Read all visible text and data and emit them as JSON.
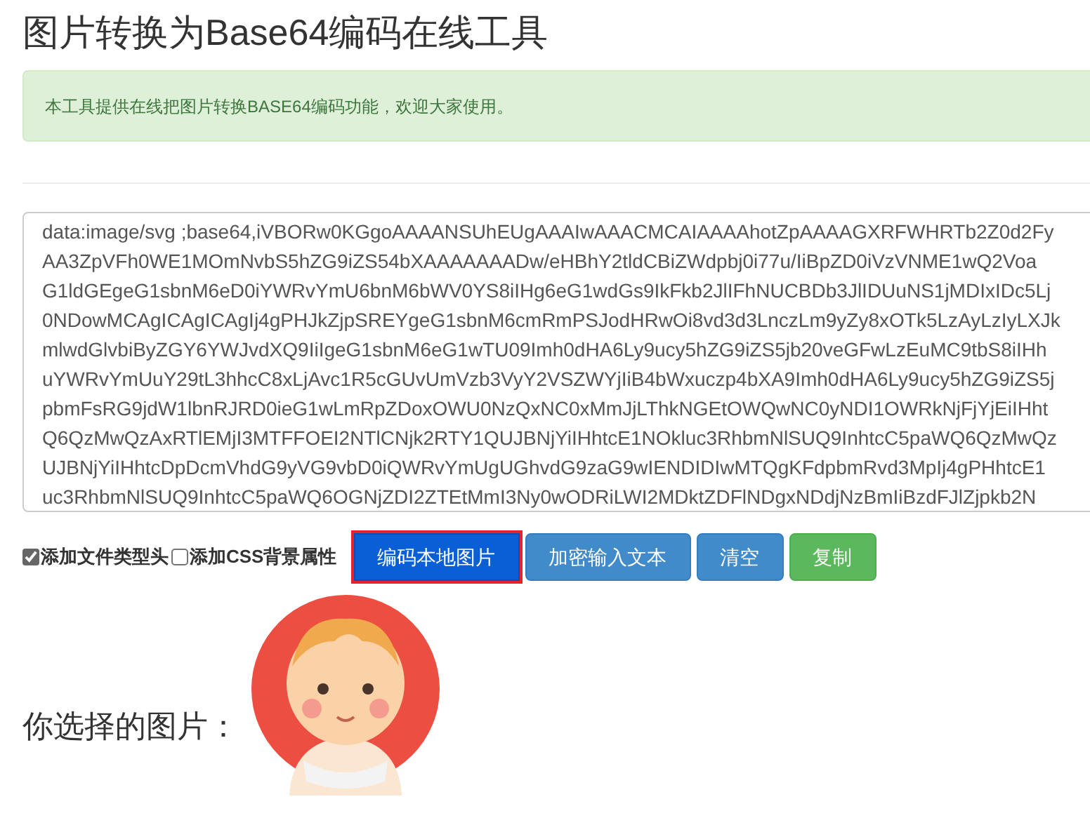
{
  "title": "图片转换为Base64编码在线工具",
  "notice": "本工具提供在线把图片转换BASE64编码功能，欢迎大家使用。",
  "base64_lines": [
    "data:image/svg ;base64,iVBORw0KGgoAAAANSUhEUgAAAIwAAACMCAIAAAAhotZpAAAAGXRFWHRTb2Z0d2Fy",
    "AA3ZpVFh0WE1MOmNvbS5hZG9iZS54bXAAAAAAADw/eHBhY2tldCBiZWdpbj0i77u/IiBpZD0iVzVNME1wQ2Voa",
    "G1ldGEgeG1sbnM6eD0iYWRvYmU6bnM6bWV0YS8iIHg6eG1wdGs9IkFkb2JlIFhNUCBDb3JlIDUuNS1jMDIxIDc5Lj",
    "0NDowMCAgICAgICAgIj4gPHJkZjpSREYgeG1sbnM6cmRmPSJodHRwOi8vd3d3LnczLm9yZy8xOTk5LzAyLzIyLXJk",
    "mlwdGlvbiByZGY6YWJvdXQ9IiIgeG1sbnM6eG1wTU09Imh0dHA6Ly9ucy5hZG9iZS5jb20veGFwLzEuMC9tbS8iIHh",
    "uYWRvYmUuY29tL3hhcC8xLjAvc1R5cGUvUmVzb3VyY2VSZWYjIiB4bWxuczp4bXA9Imh0dHA6Ly9ucy5hZG9iZS5j",
    "pbmFsRG9jdW1lbnRJRD0ieG1wLmRpZDoxOWU0NzQxNC0xMmJjLThkNGEtOWQwNC0yNDI1OWRkNjFjYjEiIHht",
    "Q6QzMwQzAxRTlEMjI3MTFFOEI2NTlCNjk2RTY1QUJBNjYiIHhtcE1NOkluc3RhbmNlSUQ9InhtcC5paWQ6QzMwQz",
    "UJBNjYiIHhtcDpDcmVhdG9yVG9vbD0iQWRvYmUgUGhvdG9zaG9wIENDIDIwMTQgKFdpbmRvd3MpIj4gPHhtcE1",
    "uc3RhbmNlSUQ9InhtcC5paWQ6OGNjZDI2ZTEtMmI3Ny0wODRiLWI2MDktZDFlNDgxNDdjNzBmIiBzdFJlZjpkb2N"
  ],
  "options": [
    {
      "label": "添加文件类型头",
      "checked": true
    },
    {
      "label": "添加CSS背景属性",
      "checked": false
    }
  ],
  "buttons": [
    {
      "label": "编码本地图片",
      "kind": "primary",
      "selected": true
    },
    {
      "label": "加密输入文本",
      "kind": "info",
      "selected": false
    },
    {
      "label": "清空",
      "kind": "info",
      "selected": false
    },
    {
      "label": "复制",
      "kind": "success",
      "selected": false
    }
  ],
  "preview_label": "你选择的图片："
}
